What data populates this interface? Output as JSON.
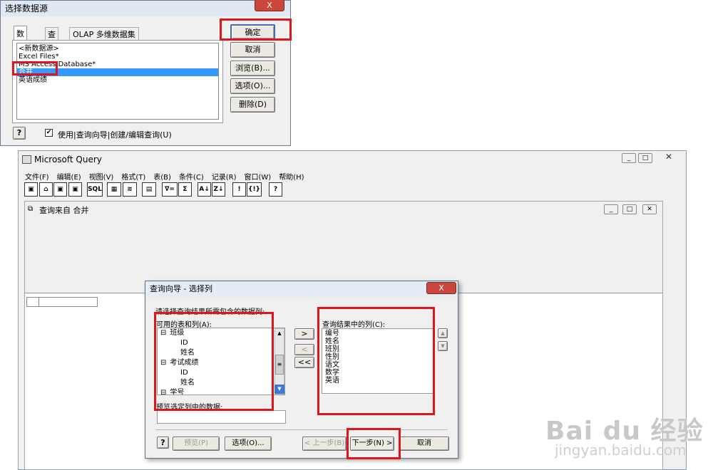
{
  "ds": {
    "title": "选择数据源",
    "close": "X",
    "tabs": [
      "数据库",
      "查询",
      "OLAP 多维数据集"
    ],
    "items": [
      "<新数据源>",
      "Excel Files*",
      "MS Access Database*",
      "合并",
      "英语成绩"
    ],
    "ok": "确定",
    "cancel": "取消",
    "browse": "浏览(B)...",
    "options": "选项(O)...",
    "delete": "删除(D)",
    "help": "?",
    "check": "✔",
    "checkLabel": "使用|查询向导|创建/编辑查询(U)"
  },
  "mq": {
    "title": "Microsoft Query",
    "menus": [
      "文件(F)",
      "编辑(E)",
      "视图(V)",
      "格式(T)",
      "表(B)",
      "条件(C)",
      "记录(R)",
      "窗口(W)",
      "帮助(H)"
    ],
    "toolbar": [
      "▣",
      "⌂",
      "▣",
      "▣",
      "SQL",
      "▦",
      "≋",
      "▤",
      "∇=",
      "Σ",
      "A↓",
      "Z↓",
      "!",
      "{!}",
      "?"
    ],
    "child": "查询来自 合并"
  },
  "wiz": {
    "title": "查询向导 - 选择列",
    "close": "X",
    "prompt": "请选择查询结果所需包含的数据列:",
    "availLabel": "可用的表和列(A):",
    "tree": [
      {
        "exp": "⊟",
        "t": "班级"
      },
      {
        "exp": "",
        "t": "ID"
      },
      {
        "exp": "",
        "t": "姓名"
      },
      {
        "exp": "⊟",
        "t": "考试成绩"
      },
      {
        "exp": "",
        "t": "ID"
      },
      {
        "exp": "",
        "t": "姓名"
      },
      {
        "exp": "⊟",
        "t": "学号"
      }
    ],
    "resultLabel": "查询结果中的列(C):",
    "results": [
      "编号",
      "姓名",
      "班别",
      "性别",
      "语文",
      "数学",
      "英语"
    ],
    "add": ">",
    "remove": "<",
    "removeAll": "<<",
    "up": "▲",
    "down": "▼",
    "previewLabel": "预览选定列中的数据:",
    "help": "?",
    "preview": "预览(P)",
    "options": "选项(O)...",
    "back": "< 上一步(B)",
    "next": "下一步(N) >",
    "cancel": "取消"
  },
  "watermark": {
    "brand": "Bai du 经验",
    "url": "jingyan.baidu.com"
  }
}
